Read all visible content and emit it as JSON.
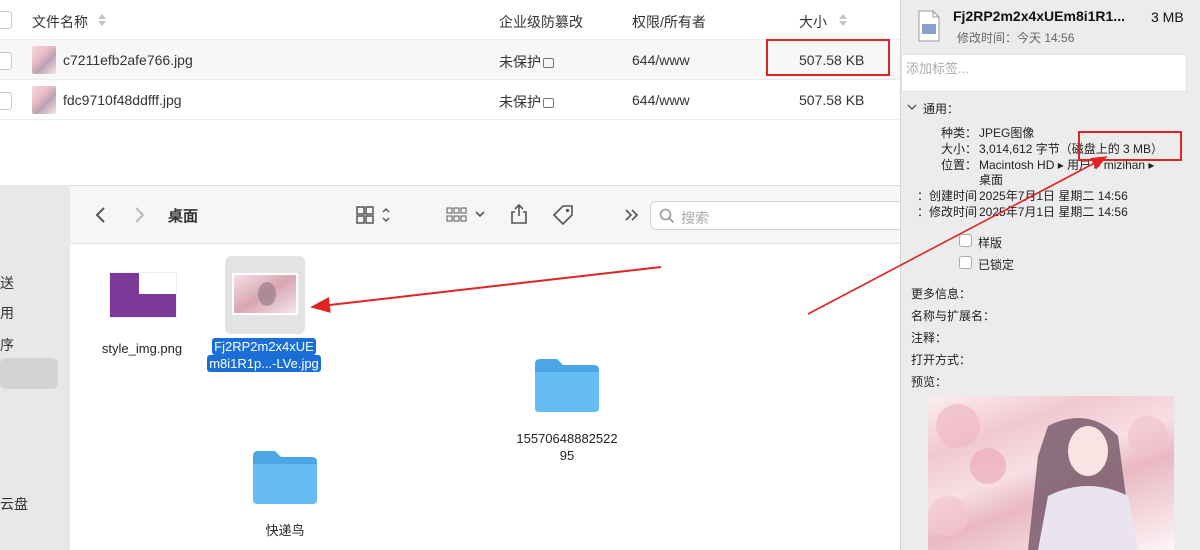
{
  "file_table": {
    "headers": {
      "name": "文件名称",
      "protect": "企业级防篡改",
      "perm": "权限/所有者",
      "size": "大小"
    },
    "rows": [
      {
        "name": "c7211efb2afe766.jpg",
        "protect": "未保护",
        "perm": "644/www",
        "size": "507.58 KB"
      },
      {
        "name": "fdc9710f48ddfff.jpg",
        "protect": "未保护",
        "perm": "644/www",
        "size": "507.58 KB"
      }
    ]
  },
  "sidebar": {
    "items": [
      "送",
      "用",
      "序",
      "云盘"
    ]
  },
  "finder": {
    "title": "桌面",
    "search_placeholder": "搜索",
    "items": [
      {
        "name": "style_img.png",
        "kind": "image"
      },
      {
        "name_line1": "Fj2RP2m2x4xUE",
        "name_line2": "m8i1R1p...-LVe.jpg",
        "kind": "image",
        "selected": true
      },
      {
        "name_line1": "15570648882522",
        "name_line2": "95",
        "kind": "folder"
      },
      {
        "name": "快递鸟",
        "kind": "folder"
      }
    ]
  },
  "info_panel": {
    "title": "Fj2RP2m2x4xUEm8i1R1...",
    "size_short": "3 MB",
    "modified": "修改时间：今天 14:56",
    "tag_placeholder": "添加标签...",
    "general_header": "通用：",
    "kind_label": "种类：",
    "kind_value": "JPEG图像",
    "size_label": "大小：",
    "size_value": "3,014,612 字节（磁盘上的 3 MB）",
    "where_label": "位置：",
    "where_value": "Macintosh HD ▸ 用户 ▸ mizihan ▸",
    "where_value2": "桌面",
    "created_label": "创建时间：",
    "created_value": "2025年7月1日 星期二 14:56",
    "modified_label": "修改时间：",
    "modified_value": "2025年7月1日 星期二 14:56",
    "stationery_label": "样版",
    "locked_label": "已锁定",
    "more_info": "更多信息：",
    "name_ext": "名称与扩展名：",
    "comments": "注释：",
    "open_with": "打开方式：",
    "preview": "预览："
  },
  "colors": {
    "annotation_red": "#e02424",
    "selection_blue": "#1a6fd7",
    "folder_blue": "#5ab3ef",
    "style_purple": "#7b3a98"
  }
}
